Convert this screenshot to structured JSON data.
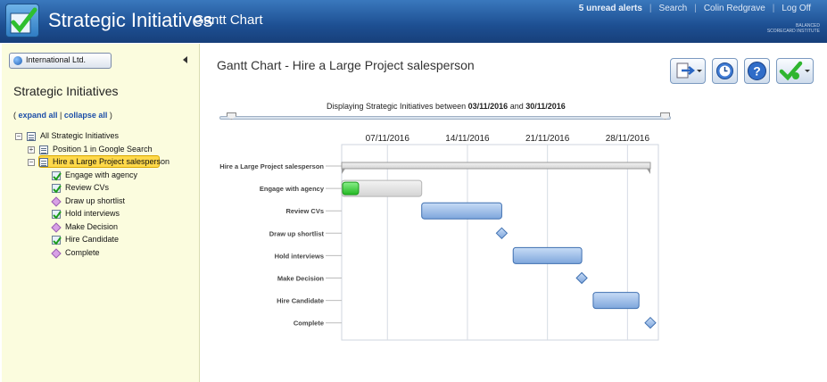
{
  "header": {
    "app_title": "Strategic Initiatives",
    "sub_title": "Gantt Chart",
    "nav": {
      "alerts": "5 unread alerts",
      "search": "Search",
      "user": "Colin Redgrave",
      "logoff": "Log Off"
    },
    "brand": "BALANCED SCORECARD INSTITUTE"
  },
  "sidebar": {
    "org": "International Ltd.",
    "title": "Strategic Initiatives",
    "expand_all": "expand all",
    "collapse_all": "collapse all",
    "tree": [
      {
        "label": "All Strategic Initiatives",
        "level": 0,
        "icon": "list-icon",
        "toggle": "−"
      },
      {
        "label": "Position 1 in Google Search",
        "level": 1,
        "icon": "list-icon",
        "toggle": "+"
      },
      {
        "label": "Hire a Large Project salesperson",
        "level": 1,
        "icon": "list-icon",
        "toggle": "−",
        "selected": true
      },
      {
        "label": "Engage with agency",
        "level": 2,
        "icon": "check-icon"
      },
      {
        "label": "Review CVs",
        "level": 2,
        "icon": "check-icon"
      },
      {
        "label": "Draw up shortlist",
        "level": 2,
        "icon": "milestone-icon"
      },
      {
        "label": "Hold interviews",
        "level": 2,
        "icon": "check-icon"
      },
      {
        "label": "Make Decision",
        "level": 2,
        "icon": "milestone-icon"
      },
      {
        "label": "Hire Candidate",
        "level": 2,
        "icon": "check-icon"
      },
      {
        "label": "Complete",
        "level": 2,
        "icon": "milestone-icon"
      }
    ]
  },
  "main": {
    "title": "Gantt Chart - Hire a Large Project salesperson",
    "range_prefix": "Displaying Strategic Initiatives between",
    "range_start": "03/11/2016",
    "range_and": "and",
    "range_end": "30/11/2016",
    "toolbar": [
      "export-icon",
      "history-icon",
      "help-icon",
      "approve-icon"
    ]
  },
  "chart_data": {
    "type": "gantt",
    "x_ticks": [
      "07/11/2016",
      "14/11/2016",
      "21/11/2016",
      "28/11/2016"
    ],
    "tasks": [
      {
        "name": "Hire a Large Project salesperson",
        "kind": "summary",
        "start": "2016-11-03",
        "end": "2016-11-30"
      },
      {
        "name": "Engage with agency",
        "kind": "task",
        "start": "2016-11-03",
        "end": "2016-11-10",
        "progress": 0.2
      },
      {
        "name": "Review CVs",
        "kind": "task",
        "start": "2016-11-10",
        "end": "2016-11-17",
        "progress": 0
      },
      {
        "name": "Draw up shortlist",
        "kind": "milestone",
        "start": "2016-11-17"
      },
      {
        "name": "Hold interviews",
        "kind": "task",
        "start": "2016-11-18",
        "end": "2016-11-24",
        "progress": 0
      },
      {
        "name": "Make Decision",
        "kind": "milestone",
        "start": "2016-11-24"
      },
      {
        "name": "Hire Candidate",
        "kind": "task",
        "start": "2016-11-25",
        "end": "2016-11-29",
        "progress": 0
      },
      {
        "name": "Complete",
        "kind": "milestone",
        "start": "2016-11-30"
      }
    ],
    "colors": {
      "bar": "#8fb4e6",
      "bar_edge": "#3e6fb0",
      "progress": "#3fd43f",
      "summary": "#e4e4e4",
      "milestone": "#8fb4e6"
    }
  }
}
